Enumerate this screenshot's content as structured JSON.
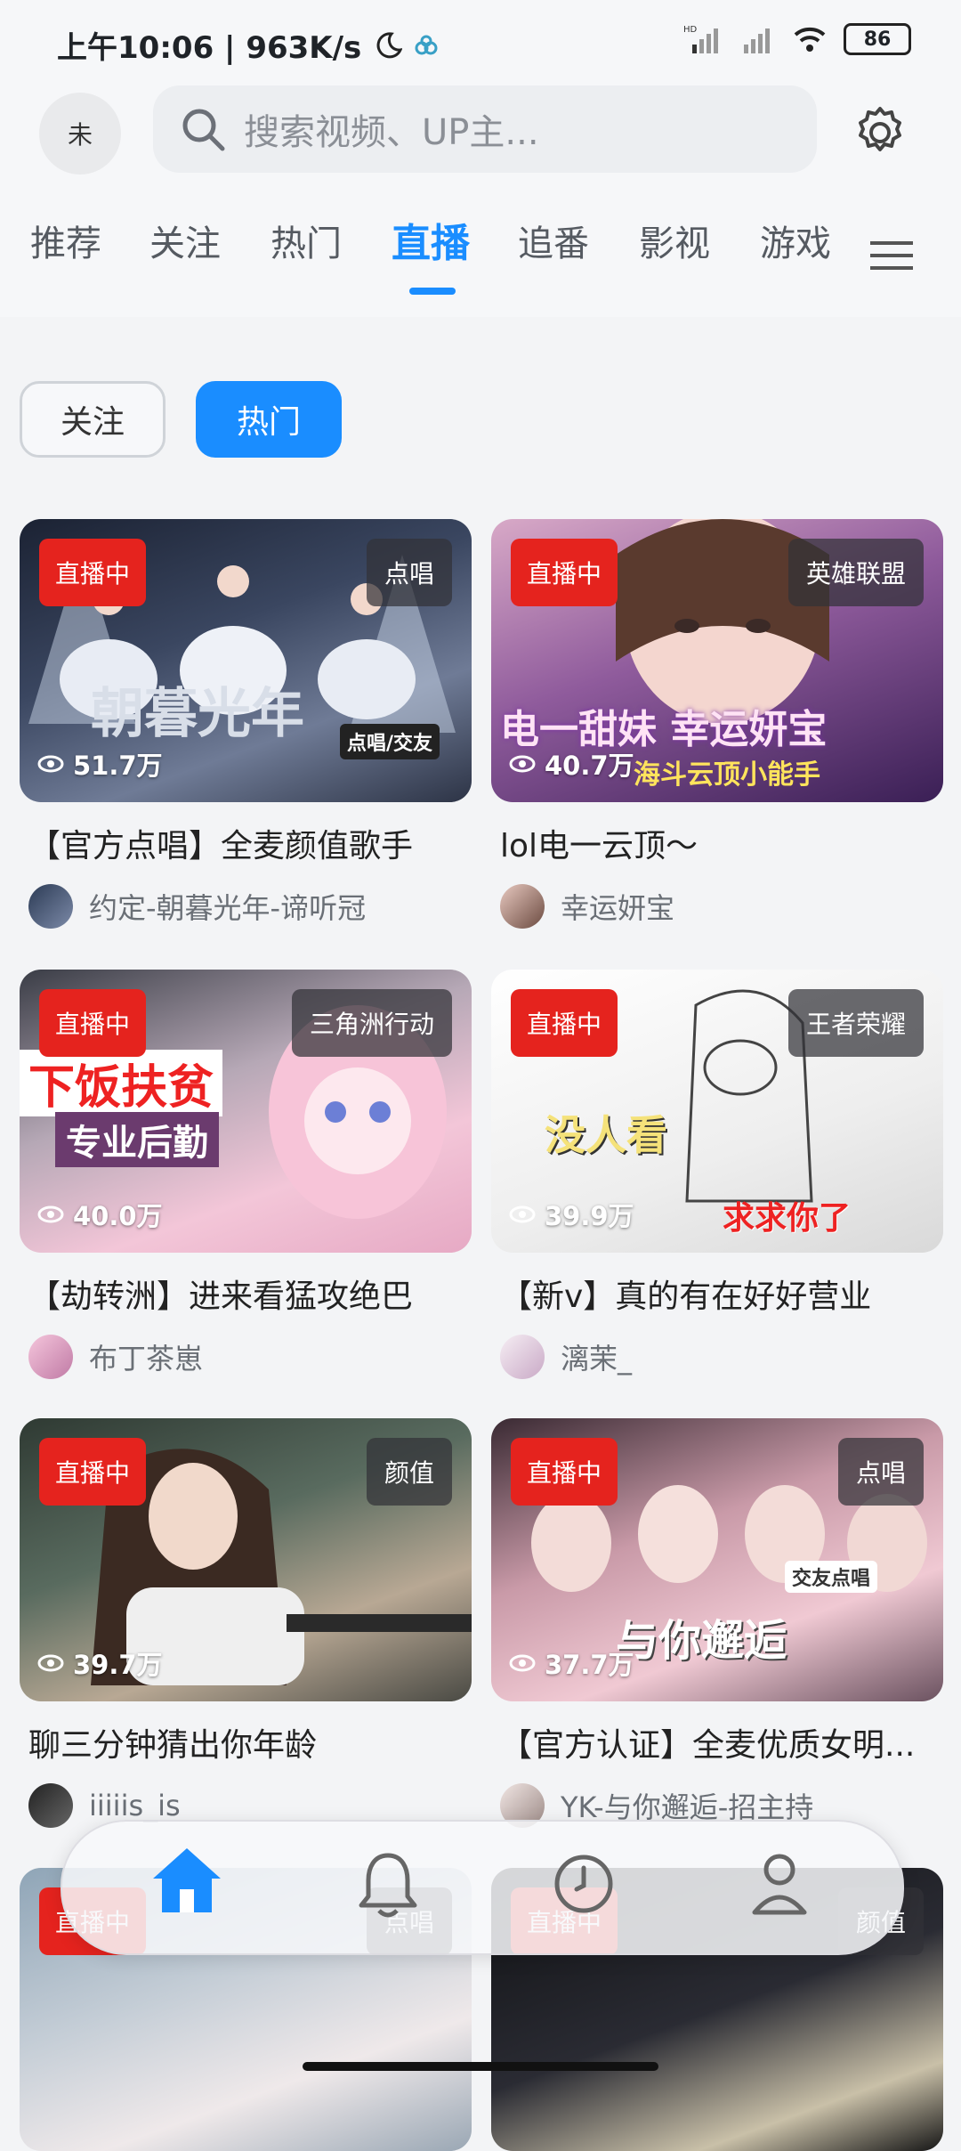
{
  "status": {
    "time_speed": "上午10:06 | 963K/s",
    "battery": "86"
  },
  "header": {
    "avatar_text": "未",
    "search_placeholder": "搜索视频、UP主..."
  },
  "tabs": [
    "推荐",
    "关注",
    "热门",
    "直播",
    "追番",
    "影视",
    "游戏"
  ],
  "active_tab": "直播",
  "filters": {
    "follow": "关注",
    "hot": "热门"
  },
  "live_label": "直播中",
  "cards": [
    {
      "category": "点唱",
      "viewers": "51.7万",
      "title": "【官方点唱】全麦颜值歌手",
      "user": "约定-朝暮光年-谛听冠",
      "overlay": "朝暮光年",
      "overlay2": "点唱/交友"
    },
    {
      "category": "英雄联盟",
      "viewers": "40.7万",
      "title": "lol电一云顶～",
      "user": "幸运妍宝",
      "overlay": "电一甜妹 幸运妍宝",
      "overlay2": "海斗云顶小能手"
    },
    {
      "category": "三角洲行动",
      "viewers": "40.0万",
      "title": "【劫转洲】进来看猛攻绝巴",
      "user": "布丁茶崽",
      "overlay": "下饭扶贫",
      "overlay2": "专业后勤"
    },
    {
      "category": "王者荣耀",
      "viewers": "39.9万",
      "title": "【新v】真的有在好好营业",
      "user": "漓茉_",
      "overlay": "没人看",
      "overlay2": "求求你了"
    },
    {
      "category": "颜值",
      "viewers": "39.7万",
      "title": "聊三分钟猜出你年龄",
      "user": "iiiiis_is",
      "overlay": "",
      "overlay2": ""
    },
    {
      "category": "点唱",
      "viewers": "37.7万",
      "title": "【官方认证】全麦优质女明...",
      "user": "YK-与你邂逅-招主持",
      "overlay": "与你邂逅",
      "overlay2": "交友点唱"
    },
    {
      "category": "点唱",
      "viewers": "",
      "title": "",
      "user": "",
      "overlay": "",
      "overlay2": ""
    },
    {
      "category": "颜值",
      "viewers": "",
      "title": "",
      "user": "",
      "overlay": "",
      "overlay2": ""
    }
  ],
  "colors": {
    "accent": "#1a8dff",
    "live_red": "#e5231e"
  },
  "bottom_nav": [
    "home-icon",
    "bell-icon",
    "clock-icon",
    "profile-icon"
  ]
}
